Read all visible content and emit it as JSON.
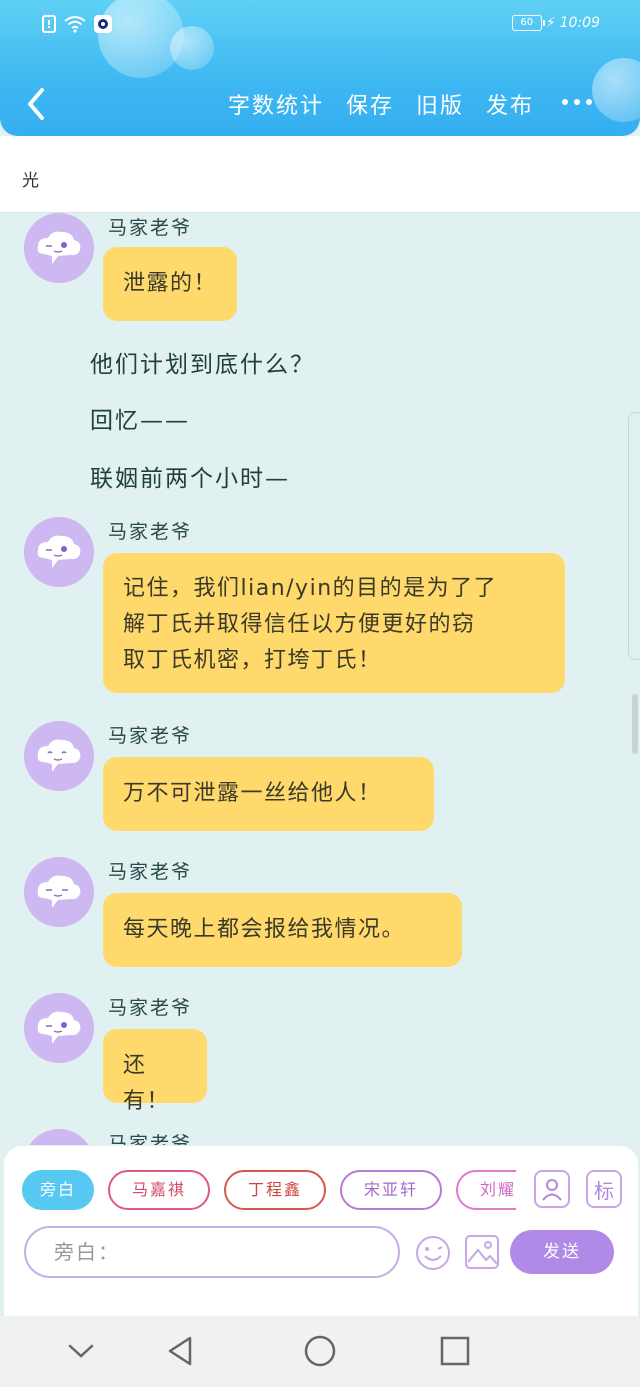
{
  "status_bar": {
    "time": "10:09",
    "battery": "60",
    "icons": [
      "alert-icon",
      "wifi-icon",
      "app-badge-icon",
      "charging-icon"
    ]
  },
  "toolbar": {
    "back_icon": "chevron-left-icon",
    "actions": [
      "字数统计",
      "保存",
      "旧版",
      "发布"
    ],
    "more_icon": "more-dots-icon"
  },
  "title": "光",
  "messages": [
    {
      "type": "dialog",
      "sender": "马家老爷",
      "lines": [
        "泄露的！"
      ]
    },
    {
      "type": "narration",
      "text": "他们计划到底什么？"
    },
    {
      "type": "narration",
      "text": "回忆——"
    },
    {
      "type": "narration",
      "text": "联姻前两个小时—"
    },
    {
      "type": "dialog",
      "sender": "马家老爷",
      "lines": [
        "记住，我们lian/yin的目的是为了了",
        "解丁氏并取得信任以方便更好的窃",
        "取丁氏机密，打垮丁氏！"
      ]
    },
    {
      "type": "dialog",
      "sender": "马家老爷",
      "lines": [
        "万不可泄露一丝给他人！"
      ]
    },
    {
      "type": "dialog",
      "sender": "马家老爷",
      "lines": [
        "每天晚上都会报给我情况。"
      ]
    },
    {
      "type": "dialog",
      "sender": "马家老爷",
      "lines": [
        "还有！"
      ]
    },
    {
      "type": "dialog",
      "sender": "马家老爷",
      "lines": []
    }
  ],
  "composer": {
    "chips": [
      "旁白",
      "马嘉祺",
      "丁程鑫",
      "宋亚轩",
      "刘耀文"
    ],
    "side_icons": [
      "person-card-icon",
      "标"
    ],
    "input_placeholder": "旁白：",
    "send_label": "发送",
    "emoji_icon": "smiley-icon",
    "image_icon": "image-icon"
  },
  "system_nav": [
    "chevron-down-icon",
    "back-triangle-icon",
    "home-circle-icon",
    "recents-square-icon"
  ],
  "colors": {
    "header": "#3eb8f2",
    "bubble": "#ffd96b",
    "avatar": "#cdb8f2",
    "send": "#b08ae6",
    "background": "#e1f0f0"
  }
}
